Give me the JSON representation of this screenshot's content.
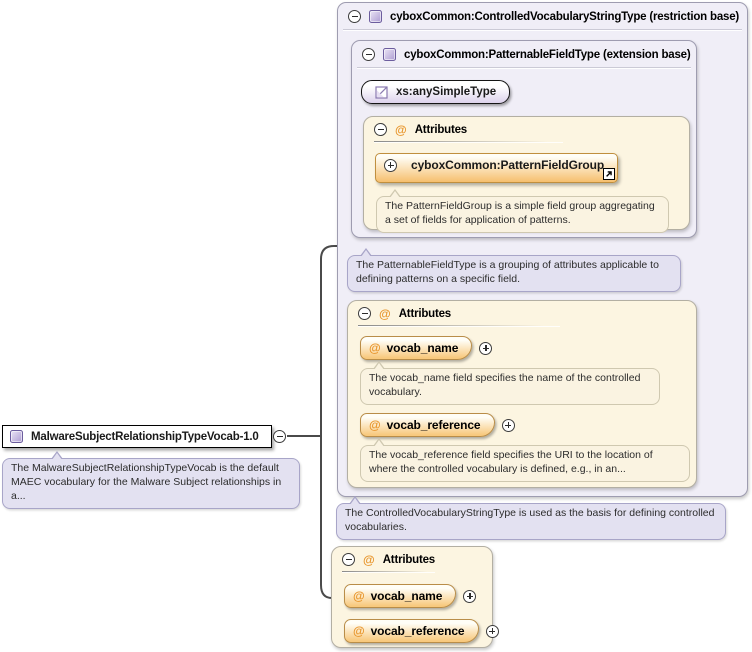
{
  "diagram": {
    "element": {
      "label": "MalwareSubjectRelationshipTypeVocab-1.0",
      "description": "The MalwareSubjectRelationshipTypeVocab is the default MAEC vocabulary for the Malware Subject relationships in a..."
    },
    "restriction": {
      "label": "cyboxCommon:ControlledVocabularyStringType (restriction base)",
      "description": "The ControlledVocabularyStringType is used as the basis for defining controlled vocabularies.",
      "extension": {
        "label": "cyboxCommon:PatternableFieldType (extension base)",
        "base_type": "xs:anySimpleType",
        "description": "The PatternableFieldType is a grouping of attributes applicable to defining patterns on a specific field.",
        "attributes": {
          "label": "Attributes",
          "group_ref": {
            "label": "cyboxCommon:PatternFieldGroup",
            "description": "The PatternFieldGroup is a simple field group aggregating a set of fields for application of patterns."
          }
        }
      },
      "attributes": {
        "label": "Attributes",
        "items": [
          {
            "name": "vocab_name",
            "description": "The vocab_name field specifies the name of the controlled vocabulary."
          },
          {
            "name": "vocab_reference",
            "description": "The vocab_reference field specifies the URI to the location of where the controlled vocabulary is defined, e.g., in an..."
          }
        ]
      }
    },
    "element_attributes": {
      "label": "Attributes",
      "items": [
        {
          "name": "vocab_name"
        },
        {
          "name": "vocab_reference"
        }
      ]
    },
    "icons": {
      "collapse": "minus-circle",
      "expand": "plus-circle",
      "attribute": "@",
      "goto_arrow": "arrow-up-right"
    },
    "colors": {
      "container_bg": "#f0eef7",
      "container_border": "#9e9cb0",
      "attr_box_bg": "#fcf5e1",
      "attr_box_border": "#b3afa3",
      "purple_bubble_bg": "#e3e1f1",
      "cream_bubble_bg": "#faf3e1",
      "badge_orange": "#f8c97d",
      "accent_orange": "#e8962d",
      "type_icon_purple": "#ac9cd2",
      "connector": "#4a4a4a"
    }
  }
}
